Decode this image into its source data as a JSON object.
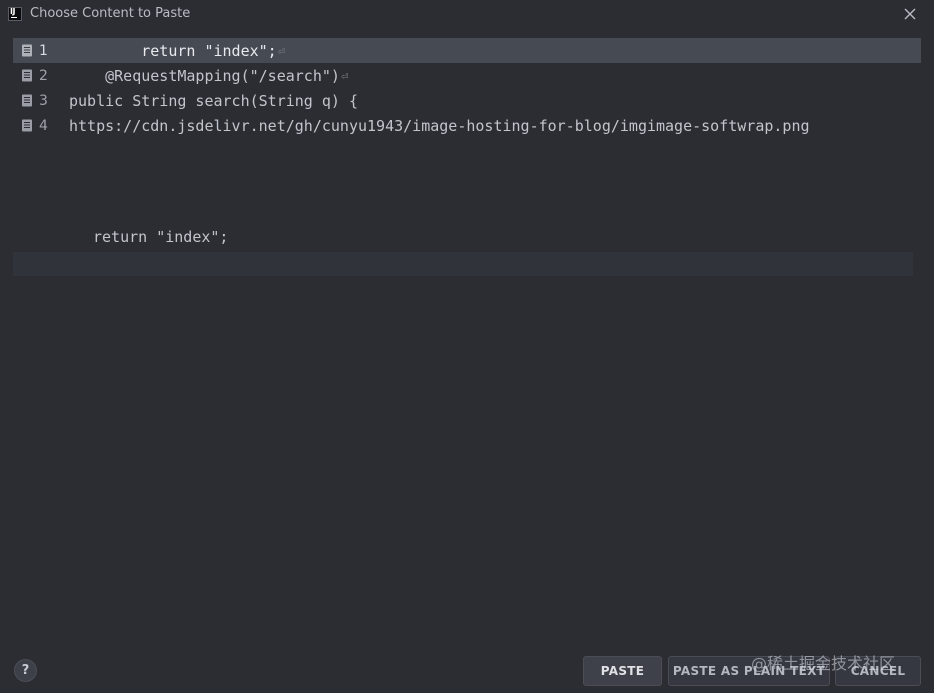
{
  "window": {
    "title": "Choose Content to Paste",
    "app_icon_text": "IJ"
  },
  "items": [
    {
      "number": "1",
      "text": "        return \"index\";",
      "has_return": true,
      "selected": true
    },
    {
      "number": "2",
      "text": "    @RequestMapping(\"/search\")",
      "has_return": true,
      "selected": false
    },
    {
      "number": "3",
      "text": "public String search(String q) {",
      "has_return": false,
      "selected": false
    },
    {
      "number": "4",
      "text": "https://cdn.jsdelivr.net/gh/cunyu1943/image-hosting-for-blog/imgimage-softwrap.png",
      "has_return": false,
      "selected": false
    }
  ],
  "preview": {
    "code": "return \"index\";"
  },
  "return_glyph": "⏎",
  "help": {
    "label": "?"
  },
  "buttons": {
    "paste": "PASTE",
    "paste_plain": "PASTE AS PLAIN TEXT",
    "cancel": "CANCEL"
  },
  "watermark": "@稀土掘金技术社区",
  "colors": {
    "background": "#2b2d33",
    "selection": "#464a52",
    "caret_line": "#30333a"
  }
}
